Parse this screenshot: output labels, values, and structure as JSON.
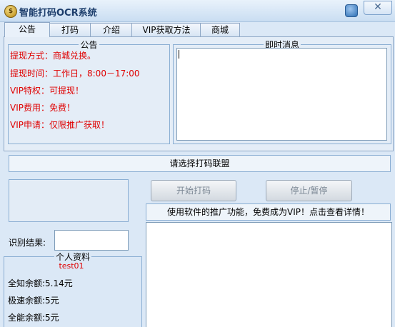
{
  "window": {
    "title": "智能打码OCR系统",
    "close_label": "✕"
  },
  "tabs": [
    "公告",
    "打码",
    "介绍",
    "VIP获取方法",
    "商城"
  ],
  "notice": {
    "legend": "公告",
    "lines": [
      "提现方式：商城兑换。",
      "提现时间：工作日，8:00－17:00",
      "VIP特权：可提现！",
      "VIP费用：免费！",
      "VIP申请：仅限推广获取！"
    ]
  },
  "messages": {
    "legend": "即时消息",
    "content": ""
  },
  "select_bar": "请选择打码联盟",
  "buttons": {
    "start": "开始打码",
    "pause": "停止/暂停"
  },
  "promo": "使用软件的推广功能，免费成为VIP！点击查看详情！",
  "result": {
    "label": "识别结果:",
    "value": ""
  },
  "profile": {
    "legend": "个人资料",
    "username": "test01",
    "balances": [
      "全知余额:5.14元",
      "极速余额:5元",
      "全能余额:5元"
    ]
  }
}
